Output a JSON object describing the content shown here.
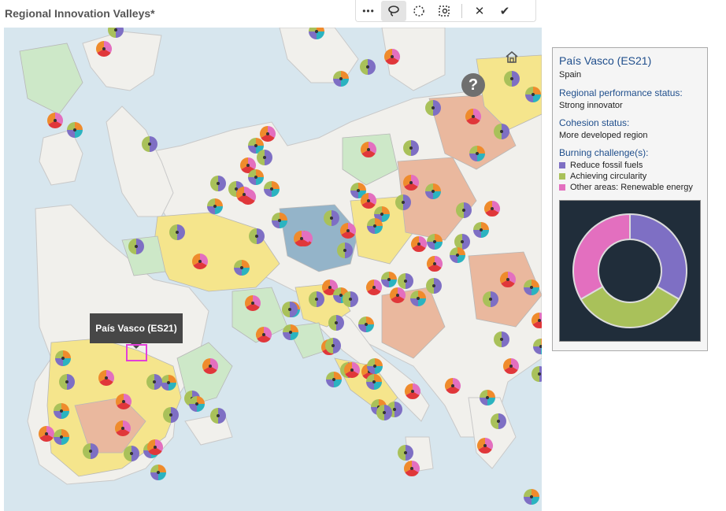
{
  "app": {
    "title": "Regional Innovation Valleys*"
  },
  "toolbar": {
    "tools": [
      {
        "name": "more-options-icon",
        "glyph": "•••",
        "active": false
      },
      {
        "name": "lasso-select-icon",
        "glyph": "⌒",
        "active": true
      },
      {
        "name": "circle-select-icon",
        "glyph": "◌",
        "active": false
      },
      {
        "name": "rect-select-icon",
        "glyph": "⬚",
        "active": false
      },
      {
        "name": "close-icon",
        "glyph": "✕",
        "active": false
      },
      {
        "name": "check-icon",
        "glyph": "✔",
        "active": false
      }
    ]
  },
  "map": {
    "tooltip": "País Vasco (ES21)",
    "help_label": "?",
    "region_colors": {
      "strong": "#f5e58c",
      "moderate": "#eab89e",
      "emerging": "#cde8c8",
      "leader": "#94b4c9"
    },
    "challenge_colors": {
      "fossil": "#7e6fc4",
      "circularity": "#a9c15a",
      "renewable": "#e36fbf",
      "other_red": "#e0373a",
      "other_orange": "#ef8b2c",
      "other_teal": "#2bb3c0"
    }
  },
  "info": {
    "region_name": "País Vasco (ES21)",
    "country": "Spain",
    "performance_label": "Regional performance status:",
    "performance_value": "Strong innovator",
    "cohesion_label": "Cohesion status:",
    "cohesion_value": "More developed region",
    "challenge_label": "Burning challenge(s):",
    "challenges": [
      {
        "label": "Reduce fossil fuels",
        "color": "#7e6fc4"
      },
      {
        "label": "Achieving circularity",
        "color": "#a9c15a"
      },
      {
        "label": "Other areas: Renewable energy",
        "color": "#e36fbf"
      }
    ]
  },
  "chart_data": {
    "type": "pie",
    "categories": [
      "Reduce fossil fuels",
      "Achieving circularity",
      "Other areas: Renewable energy"
    ],
    "values": [
      1,
      1,
      1
    ],
    "colors": [
      "#7e6fc4",
      "#a9c15a",
      "#e36fbf"
    ]
  }
}
